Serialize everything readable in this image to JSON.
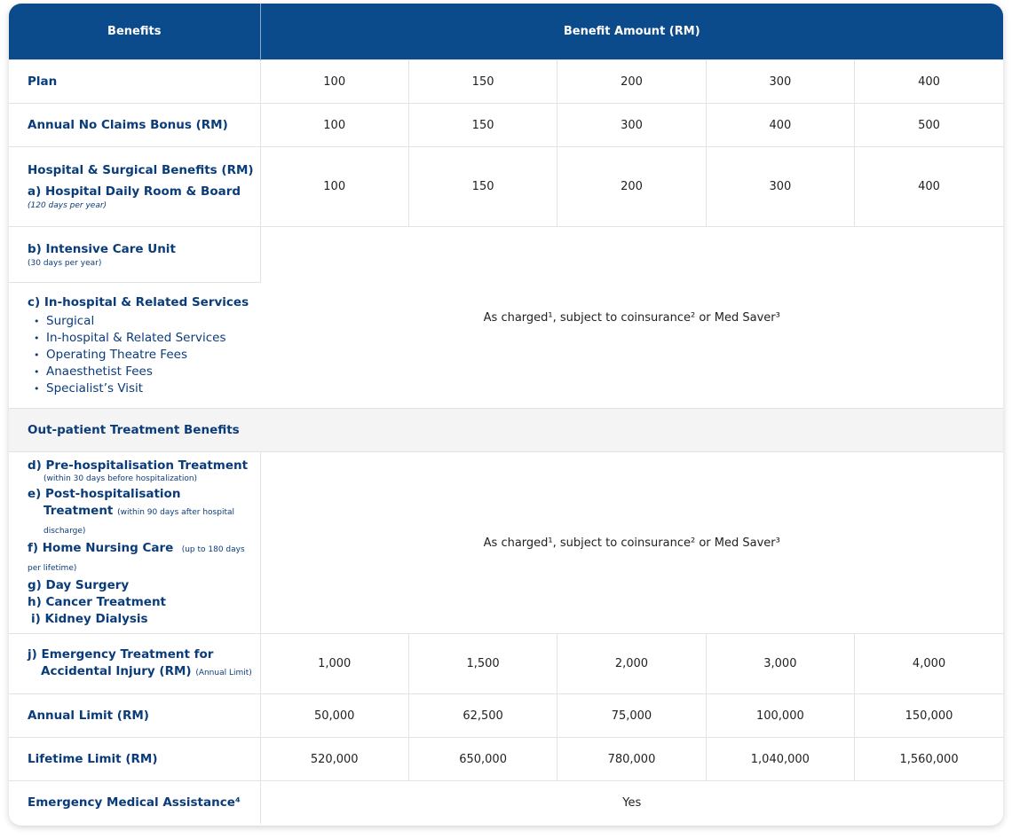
{
  "header": {
    "benefits": "Benefits",
    "amount": "Benefit Amount (RM)"
  },
  "rows": {
    "plan": {
      "label": "Plan",
      "values": [
        "100",
        "150",
        "200",
        "300",
        "400"
      ]
    },
    "ncb": {
      "label": "Annual No Claims Bonus (RM)",
      "values": [
        "100",
        "150",
        "300",
        "400",
        "500"
      ]
    },
    "hosp": {
      "title": "Hospital & Surgical Benefits (RM)",
      "label": "a) Hospital Daily Room & Board",
      "note": "(120 days per year)",
      "values": [
        "100",
        "150",
        "200",
        "300",
        "400"
      ]
    },
    "icu": {
      "label": "b) Intensive Care Unit",
      "note": "(30 days per year)"
    },
    "inhosp": {
      "label": "c) In-hospital & Related Services",
      "items": [
        "Surgical",
        "In-hospital & Related Services",
        "Operating Theatre Fees",
        "Anaesthetist Fees",
        "Specialist’s Visit"
      ]
    },
    "as_charged_1": "As charged¹, subject to coinsurance² or Med Saver³",
    "section": "Out-patient Treatment Benefits",
    "out": {
      "d": "d) Pre-hospitalisation Treatment",
      "d_note": "(within 30 days before hospitalization)",
      "e": "e) Post-hospitalisation",
      "e2": "Treatment",
      "e_note": "(within 90 days after hospital discharge)",
      "f": "f) Home Nursing Care",
      "f_note": "(up to 180 days per lifetime)",
      "g": "g) Day Surgery",
      "h": "h) Cancer Treatment",
      "i": "i) Kidney Dialysis"
    },
    "as_charged_2": "As charged¹, subject to coinsurance² or Med Saver³",
    "emerg": {
      "label": "j) Emergency Treatment for",
      "label2": "Accidental Injury (RM)",
      "note": "(Annual Limit)",
      "values": [
        "1,000",
        "1,500",
        "2,000",
        "3,000",
        "4,000"
      ]
    },
    "annual": {
      "label": "Annual Limit (RM)",
      "values": [
        "50,000",
        "62,500",
        "75,000",
        "100,000",
        "150,000"
      ]
    },
    "life": {
      "label": "Lifetime Limit (RM)",
      "values": [
        "520,000",
        "650,000",
        "780,000",
        "1,040,000",
        "1,560,000"
      ]
    },
    "ema": {
      "label": "Emergency Medical Assistance⁴",
      "value": "Yes"
    }
  }
}
